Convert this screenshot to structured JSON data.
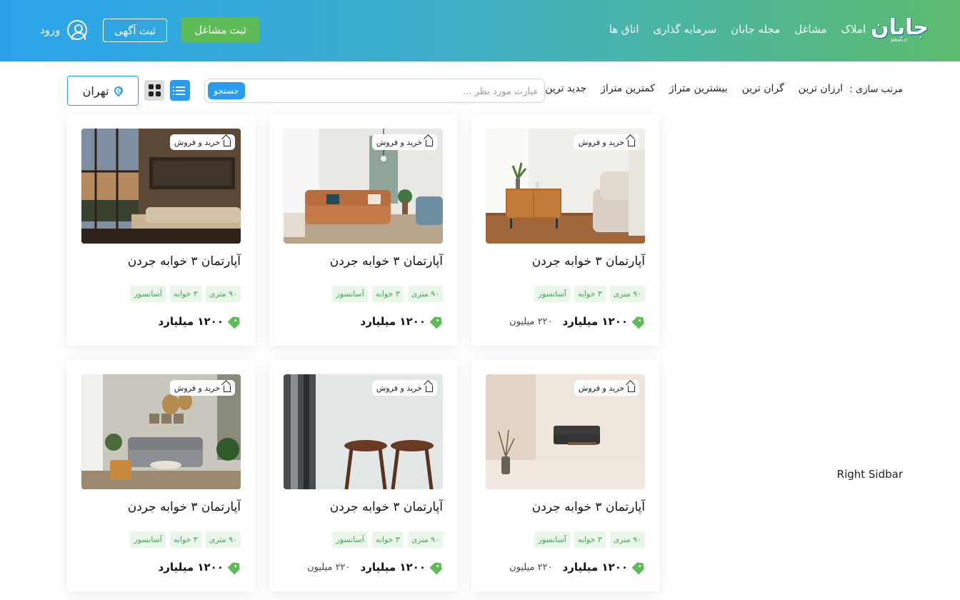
{
  "header": {
    "logo_text": "جابان",
    "logo_sub": "jaban.ir",
    "nav": [
      "املاک",
      "مشاغل",
      "مجله جابان",
      "سرمایه گذاری",
      "اتاق ها"
    ],
    "register_business": "ثبت مشاغل",
    "register_ad": "ثبت آگهی",
    "login": "ورود"
  },
  "toolbar": {
    "sort_label": "مرتب سازی :",
    "sort_options": [
      "ارزان ترین",
      "گران ترین",
      "بیشترین متراژ",
      "کمترین متراژ",
      "جدید ترین"
    ],
    "search_placeholder": "عبارت مورد نظر ...",
    "search_button": "جستجو",
    "city": "تهران"
  },
  "sidebar": {
    "label": "Right Sidbar"
  },
  "colors": {
    "accent_blue": "#2a9cf0",
    "accent_green": "#5ebc56",
    "tag_bg": "#eaf6ea",
    "tag_text": "#4aa55a"
  },
  "cards": [
    {
      "badge": "خرید و فروش",
      "title": "آپارتمان ۳ خوابه جردن",
      "tags": [
        "۹۰ متری",
        "۳ خوابه",
        "آسانسور"
      ],
      "price": "۱۲۰۰  میلیارد",
      "price_sub": "۲۲۰  میلیون",
      "image": "sideboard-room"
    },
    {
      "badge": "خرید و فروش",
      "title": "آپارتمان ۳ خوابه جردن",
      "tags": [
        "۹۰ متری",
        "۳ خوابه",
        "آسانسور"
      ],
      "price": "۱۲۰۰  میلیارد",
      "price_sub": "",
      "image": "leather-sofa-room"
    },
    {
      "badge": "خرید و فروش",
      "title": "آپارتمان ۳ خوابه جردن",
      "tags": [
        "۹۰ متری",
        "۳ خوابه",
        "آسانسور"
      ],
      "price": "۱۲۰۰  میلیارد",
      "price_sub": "",
      "image": "loft-living-room"
    },
    {
      "badge": "خرید و فروش",
      "title": "آپارتمان ۳ خوابه جردن",
      "tags": [
        "۹۰ متری",
        "۳ خوابه",
        "آسانسور"
      ],
      "price": "۱۲۰۰  میلیارد",
      "price_sub": "۲۲۰  میلیون",
      "image": "minimal-room"
    },
    {
      "badge": "خرید و فروش",
      "title": "آپارتمان ۳ خوابه جردن",
      "tags": [
        "۹۰ متری",
        "۳ خوابه",
        "آسانسور"
      ],
      "price": "۱۲۰۰  میلیارد",
      "price_sub": "۲۲۰  میلیون",
      "image": "stools"
    },
    {
      "badge": "خرید و فروش",
      "title": "آپارتمان ۳ خوابه جردن",
      "tags": [
        "۹۰ متری",
        "۳ خوابه",
        "آسانسور"
      ],
      "price": "۱۲۰۰  میلیارد",
      "price_sub": "",
      "image": "boho-living-room"
    }
  ]
}
